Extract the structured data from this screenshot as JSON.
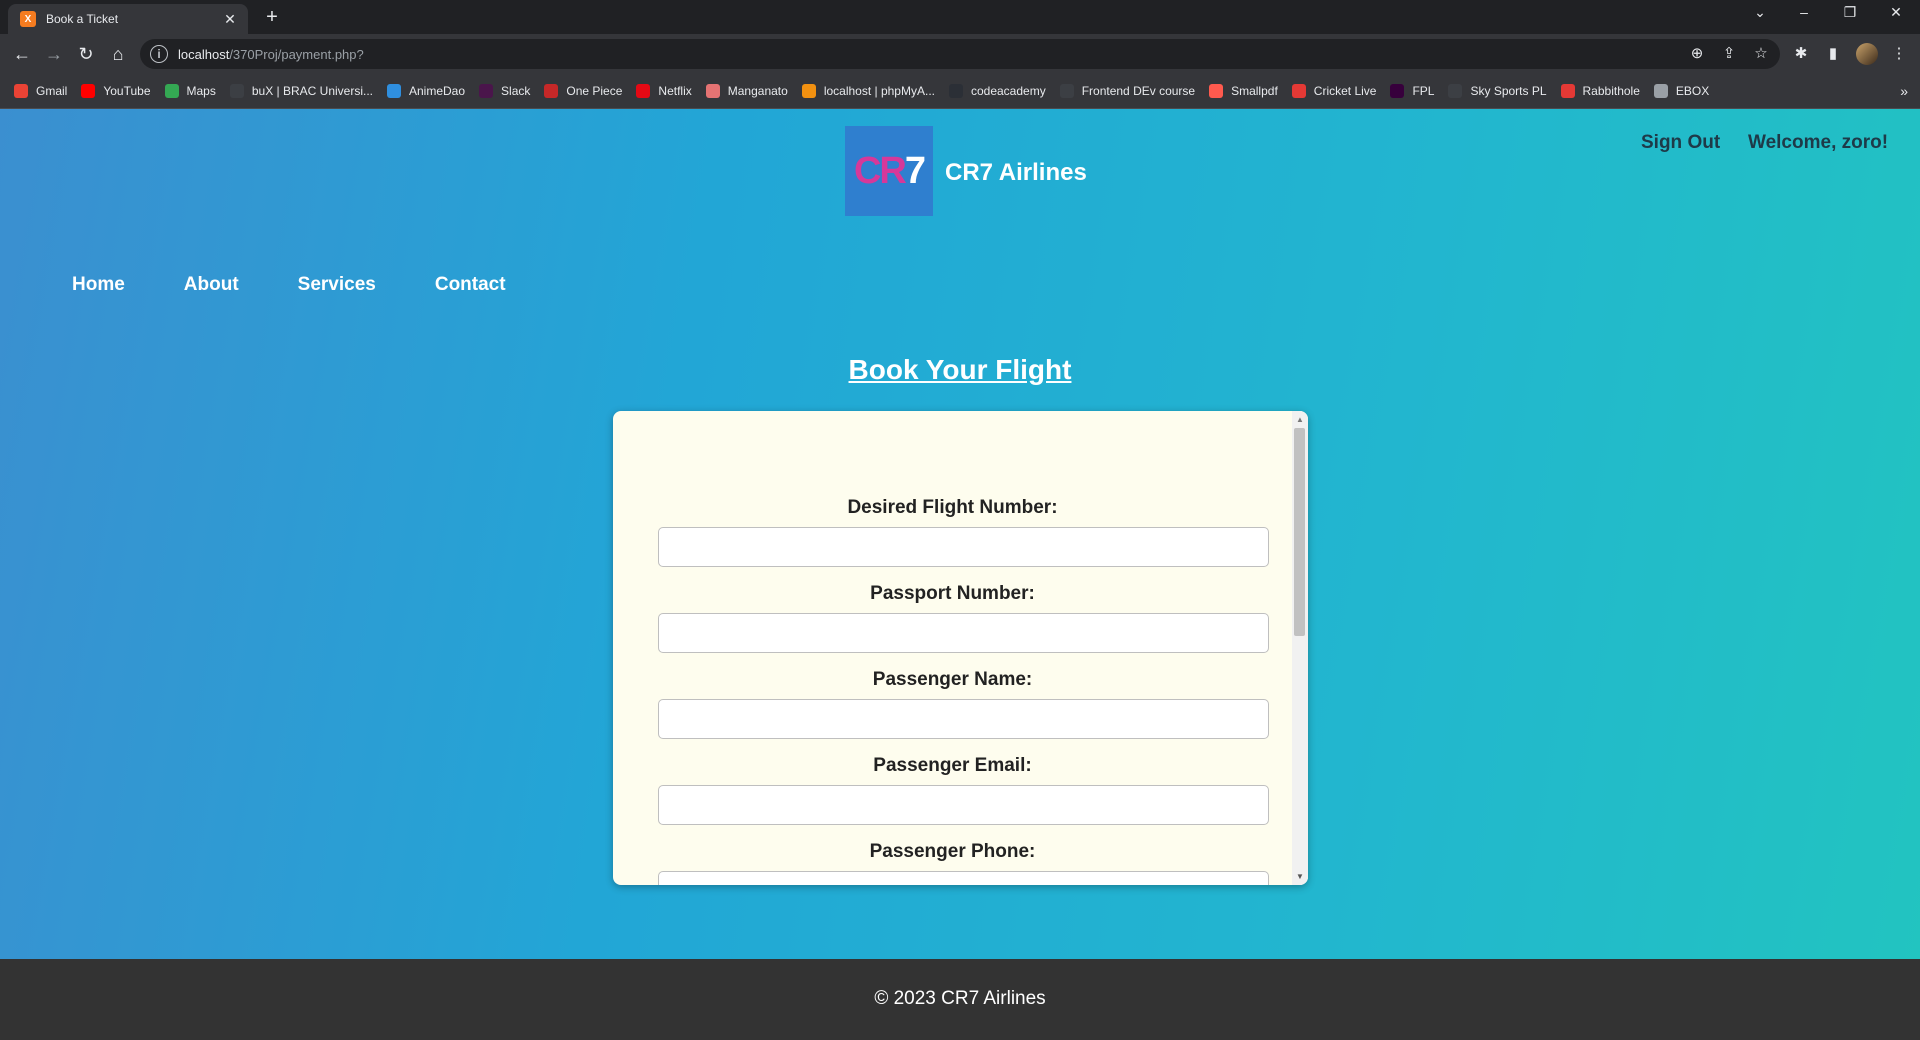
{
  "browser": {
    "tab_title": "Book a Ticket",
    "tab_favicon": "xampp-icon",
    "url_host": "localhost",
    "url_path": "/370Proj/payment.php?",
    "bookmarks": [
      {
        "label": "Gmail",
        "color": "#ea4335"
      },
      {
        "label": "YouTube",
        "color": "#ff0000"
      },
      {
        "label": "Maps",
        "color": "#34a853"
      },
      {
        "label": "buX | BRAC Universi...",
        "color": "#3c3f44"
      },
      {
        "label": "AnimeDao",
        "color": "#2f8fdf"
      },
      {
        "label": "Slack",
        "color": "#4a154b"
      },
      {
        "label": "One Piece",
        "color": "#c62828"
      },
      {
        "label": "Netflix",
        "color": "#e50914"
      },
      {
        "label": "Manganato",
        "color": "#e57373"
      },
      {
        "label": "localhost | phpMyA...",
        "color": "#f29111"
      },
      {
        "label": "codeacademy",
        "color": "#2b2f36"
      },
      {
        "label": "Frontend DEv course",
        "color": "#3c3f44"
      },
      {
        "label": "Smallpdf",
        "color": "#ff5a4e"
      },
      {
        "label": "Cricket Live",
        "color": "#e53935"
      },
      {
        "label": "FPL",
        "color": "#37003c"
      },
      {
        "label": "Sky Sports PL",
        "color": "#3c3f44"
      },
      {
        "label": "Rabbithole",
        "color": "#e53935"
      },
      {
        "label": "EBOX",
        "color": "#9aa0a6"
      }
    ]
  },
  "header": {
    "logo_text": "CR7",
    "brand": "CR7 Airlines",
    "sign_out": "Sign Out",
    "welcome": "Welcome, zoro!"
  },
  "nav": {
    "items": [
      "Home",
      "About",
      "Services",
      "Contact"
    ]
  },
  "main": {
    "heading": "Book Your Flight",
    "fields": [
      {
        "label": "Desired Flight Number:",
        "value": ""
      },
      {
        "label": "Passport Number:",
        "value": ""
      },
      {
        "label": "Passenger Name:",
        "value": ""
      },
      {
        "label": "Passenger Email:",
        "value": ""
      },
      {
        "label": "Passenger Phone:",
        "value": ""
      }
    ]
  },
  "footer": {
    "copyright": "© 2023 CR7 Airlines"
  }
}
